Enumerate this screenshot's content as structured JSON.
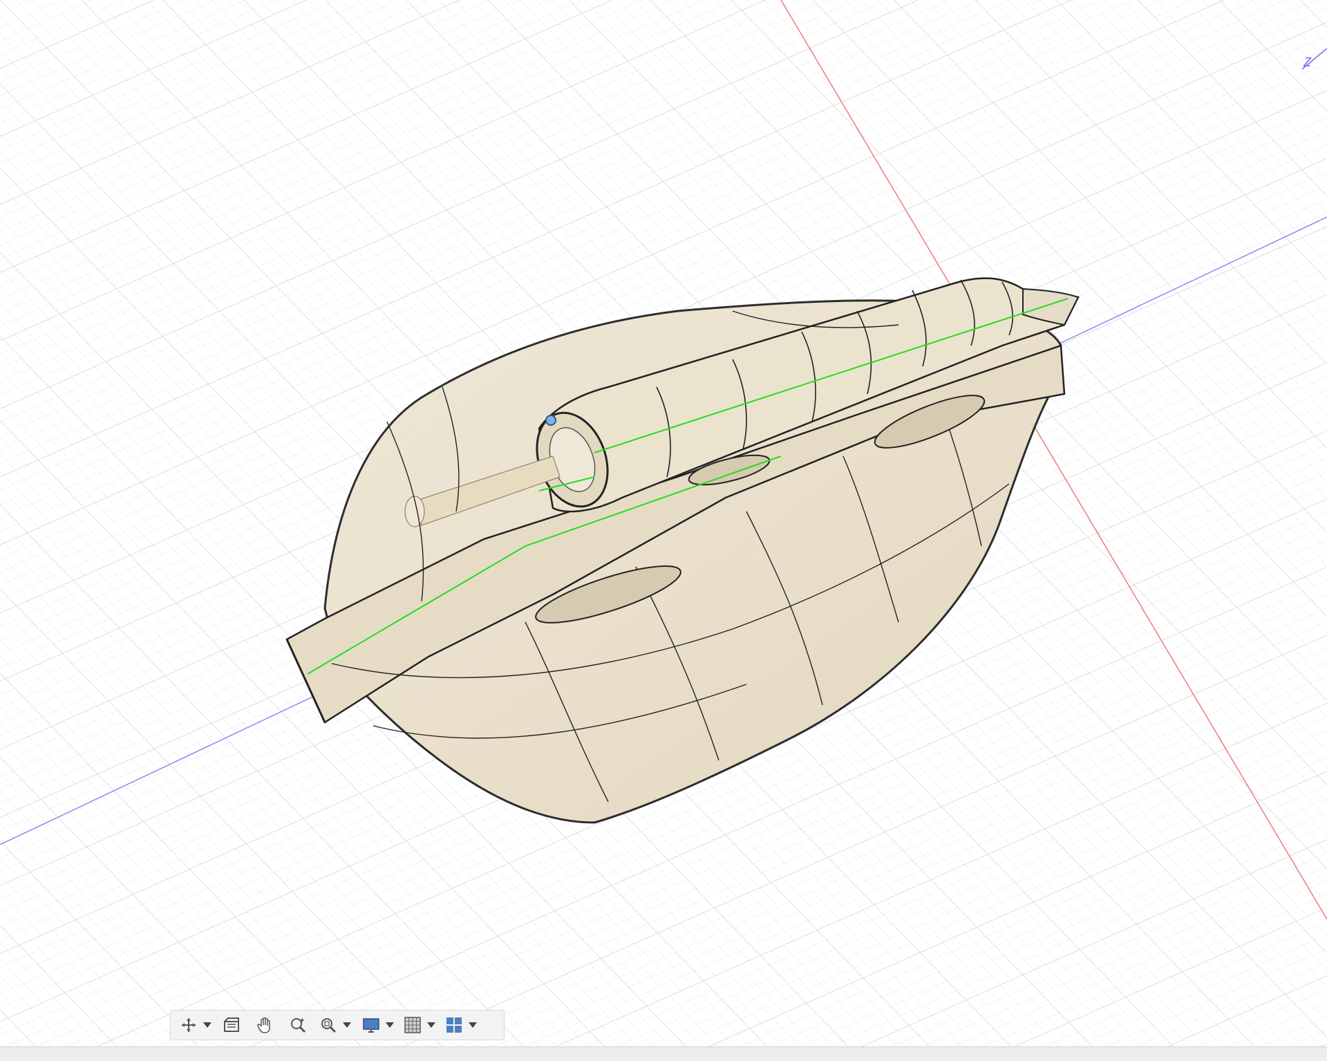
{
  "viewport": {
    "axis_label": "Z",
    "colors": {
      "grid_minor": "#e4e7ea",
      "grid_major": "#cdd1d6",
      "axis_red": "#f07a7a",
      "axis_blue": "#8a8af0",
      "body_fill": "#e9dfc9",
      "edge": "#222222",
      "highlight_edge": "#22dd22",
      "point": "#7fb3e6"
    }
  },
  "toolbar": {
    "items": [
      {
        "name": "orbit-icon",
        "has_menu": true
      },
      {
        "name": "look-at-icon",
        "has_menu": false
      },
      {
        "name": "pan-icon",
        "has_menu": false
      },
      {
        "name": "zoom-icon",
        "has_menu": false
      },
      {
        "name": "zoom-window-icon",
        "has_menu": true
      },
      {
        "name": "display-settings-icon",
        "has_menu": true
      },
      {
        "name": "grid-snaps-icon",
        "has_menu": true
      },
      {
        "name": "viewports-icon",
        "has_menu": true
      }
    ]
  }
}
